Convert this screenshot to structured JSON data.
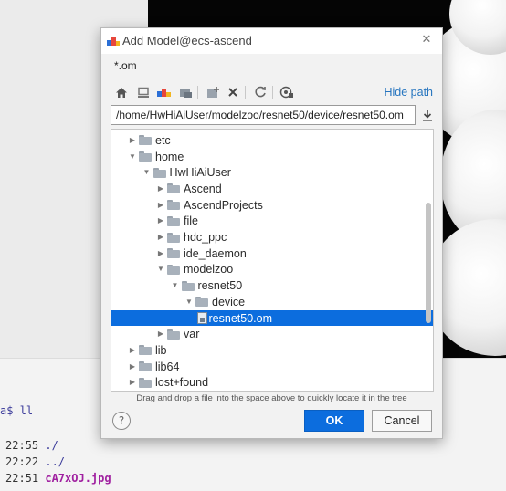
{
  "terminal": {
    "prompt_tail": "a$ ll",
    "lines": [
      {
        "time": "22:55",
        "name": "./"
      },
      {
        "time": "22:22",
        "name": "../"
      },
      {
        "time": "22:51",
        "name": "cA7xOJ.jpg"
      }
    ]
  },
  "dialog": {
    "title": "Add Model@ecs-ascend",
    "filter": "*.om",
    "toolbar": {
      "icons": [
        "home-icon",
        "desktop-icon",
        "project-icon",
        "module-icon",
        "new-folder-icon",
        "delete-icon",
        "refresh-icon",
        "show-hidden-icon"
      ],
      "hide_path_label": "Hide path"
    },
    "path_value": "/home/HwHiAiUser/modelzoo/resnet50/device/resnet50.om",
    "tree": [
      {
        "label": "etc",
        "depth": 1,
        "expanded": false,
        "type": "folder"
      },
      {
        "label": "home",
        "depth": 1,
        "expanded": true,
        "type": "folder"
      },
      {
        "label": "HwHiAiUser",
        "depth": 2,
        "expanded": true,
        "type": "folder"
      },
      {
        "label": "Ascend",
        "depth": 3,
        "expanded": false,
        "type": "folder"
      },
      {
        "label": "AscendProjects",
        "depth": 3,
        "expanded": false,
        "type": "folder"
      },
      {
        "label": "file",
        "depth": 3,
        "expanded": false,
        "type": "folder"
      },
      {
        "label": "hdc_ppc",
        "depth": 3,
        "expanded": false,
        "type": "folder"
      },
      {
        "label": "ide_daemon",
        "depth": 3,
        "expanded": false,
        "type": "folder"
      },
      {
        "label": "modelzoo",
        "depth": 3,
        "expanded": true,
        "type": "folder"
      },
      {
        "label": "resnet50",
        "depth": 4,
        "expanded": true,
        "type": "folder"
      },
      {
        "label": "device",
        "depth": 5,
        "expanded": true,
        "type": "folder"
      },
      {
        "label": "resnet50.om",
        "depth": 6,
        "expanded": false,
        "type": "file",
        "selected": true
      },
      {
        "label": "var",
        "depth": 3,
        "expanded": false,
        "type": "folder"
      },
      {
        "label": "lib",
        "depth": 1,
        "expanded": false,
        "type": "folder"
      },
      {
        "label": "lib64",
        "depth": 1,
        "expanded": false,
        "type": "folder"
      },
      {
        "label": "lost+found",
        "depth": 1,
        "expanded": false,
        "type": "folder"
      }
    ],
    "hint": "Drag and drop a file into the space above to quickly locate it in the tree",
    "help_label": "?",
    "ok_label": "OK",
    "cancel_label": "Cancel"
  },
  "colors": {
    "accent": "#0c6dde",
    "link": "#2675bf",
    "terminal_highlight": "#a020a0"
  }
}
